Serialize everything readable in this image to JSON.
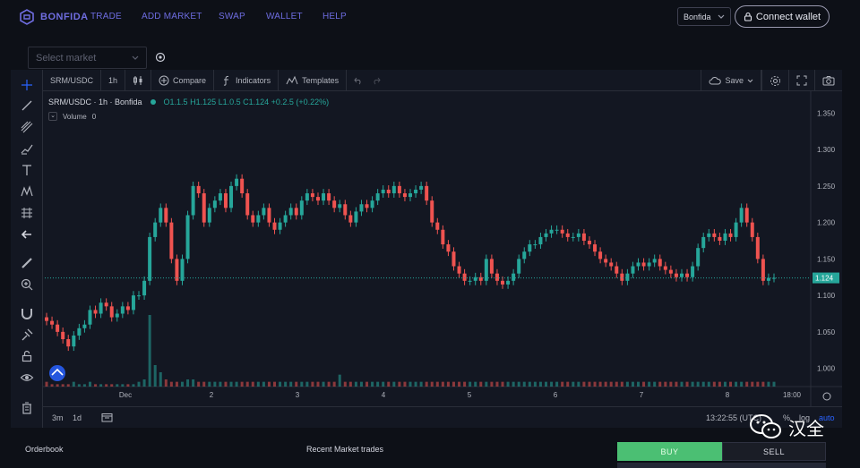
{
  "nav": {
    "logo": "BONFIDA",
    "links": [
      "TRADE",
      "ADD MARKET",
      "SWAP",
      "WALLET",
      "HELP"
    ],
    "network": "Bonfida",
    "connect_label": "Connect wallet"
  },
  "market_select": {
    "placeholder": "Select market"
  },
  "toolbar": {
    "symbol": "SRM/USDC",
    "interval": "1h",
    "compare": "Compare",
    "indicators": "Indicators",
    "templates": "Templates",
    "save": "Save"
  },
  "legend": {
    "title": "SRM/USDC · 1h · Bonfida",
    "ohlc": "O1.1.5 H1.125 L1.0.5 C1.124 +0.2.5 (+0.22%)",
    "volume_label": "Volume",
    "volume_value": "0"
  },
  "bottombar": {
    "range_3m": "3m",
    "range_1d": "1d",
    "time": "13:22:55 (UTC)",
    "pct": "%",
    "log": "log",
    "auto": "auto"
  },
  "sections": {
    "orderbook": "Orderbook",
    "recent_trades": "Recent Market trades"
  },
  "trade_buttons": {
    "buy": "BUY",
    "sell": "SELL"
  },
  "watermark": "汉全",
  "colors": {
    "up": "#26a69a",
    "down": "#ef5350",
    "accent": "#6d6ce0",
    "buy": "#4bbf73"
  },
  "chart_data": {
    "type": "candlestick",
    "price_axis": {
      "labels": [
        "1.350",
        "1.300",
        "1.250",
        "1.200",
        "1.150",
        "1.100",
        "1.050",
        "1.000"
      ],
      "ylim": [
        0.975,
        1.375
      ]
    },
    "time_axis": {
      "labels": [
        "Dec",
        "2",
        "3",
        "4",
        "5",
        "6",
        "7",
        "8",
        "18:00"
      ]
    },
    "current_price": 1.124,
    "current_price_label": "1.124",
    "series": [
      {
        "name": "SRM/USDC",
        "close": [
          1.065,
          1.06,
          1.05,
          1.04,
          1.03,
          1.045,
          1.055,
          1.06,
          1.08,
          1.075,
          1.09,
          1.085,
          1.07,
          1.075,
          1.085,
          1.08,
          1.1,
          1.1,
          1.12,
          1.18,
          1.2,
          1.22,
          1.2,
          1.15,
          1.12,
          1.15,
          1.21,
          1.25,
          1.24,
          1.2,
          1.22,
          1.23,
          1.24,
          1.22,
          1.25,
          1.26,
          1.24,
          1.21,
          1.2,
          1.21,
          1.22,
          1.2,
          1.19,
          1.2,
          1.21,
          1.22,
          1.21,
          1.23,
          1.24,
          1.235,
          1.23,
          1.24,
          1.23,
          1.22,
          1.225,
          1.21,
          1.2,
          1.215,
          1.225,
          1.22,
          1.23,
          1.24,
          1.245,
          1.24,
          1.25,
          1.24,
          1.235,
          1.24,
          1.245,
          1.25,
          1.23,
          1.2,
          1.19,
          1.17,
          1.16,
          1.14,
          1.13,
          1.12,
          1.12,
          1.125,
          1.12,
          1.15,
          1.13,
          1.12,
          1.115,
          1.12,
          1.13,
          1.15,
          1.16,
          1.17,
          1.17,
          1.18,
          1.185,
          1.19,
          1.19,
          1.185,
          1.18,
          1.18,
          1.185,
          1.175,
          1.17,
          1.16,
          1.15,
          1.145,
          1.14,
          1.13,
          1.12,
          1.13,
          1.14,
          1.145,
          1.14,
          1.145,
          1.15,
          1.14,
          1.135,
          1.13,
          1.125,
          1.13,
          1.125,
          1.14,
          1.165,
          1.18,
          1.185,
          1.18,
          1.175,
          1.185,
          1.18,
          1.2,
          1.22,
          1.2,
          1.18,
          1.15,
          1.12,
          1.124,
          1.124
        ]
      }
    ],
    "volume": {
      "values": [
        2,
        1,
        1,
        1,
        1,
        2,
        1,
        1,
        2,
        1,
        1,
        1,
        1,
        1,
        1,
        1,
        1,
        2,
        3,
        30,
        9,
        6,
        3,
        2,
        2,
        2,
        3,
        3,
        2,
        2,
        2,
        2,
        2,
        2,
        2,
        2,
        2,
        2,
        2,
        2,
        2,
        2,
        2,
        2,
        2,
        2,
        2,
        2,
        2,
        2,
        2,
        2,
        2,
        2,
        5,
        2,
        2,
        2,
        2,
        2,
        2,
        2,
        2,
        2,
        2,
        2,
        2,
        2,
        2,
        2,
        2,
        2,
        2,
        2,
        2,
        2,
        2,
        2,
        2,
        2,
        2,
        2,
        2,
        2,
        2,
        2,
        2,
        2,
        2,
        2,
        2,
        2,
        2,
        2,
        2,
        2,
        2,
        2,
        2,
        2,
        2,
        2,
        2,
        2,
        2,
        2,
        2,
        2,
        2,
        2,
        2,
        2,
        2,
        2,
        2,
        2,
        2,
        2,
        2,
        2,
        2,
        2,
        2,
        2,
        2,
        2,
        2,
        2,
        2,
        2,
        2,
        2,
        2,
        2,
        2,
        2,
        2,
        2,
        2,
        2
      ]
    }
  }
}
